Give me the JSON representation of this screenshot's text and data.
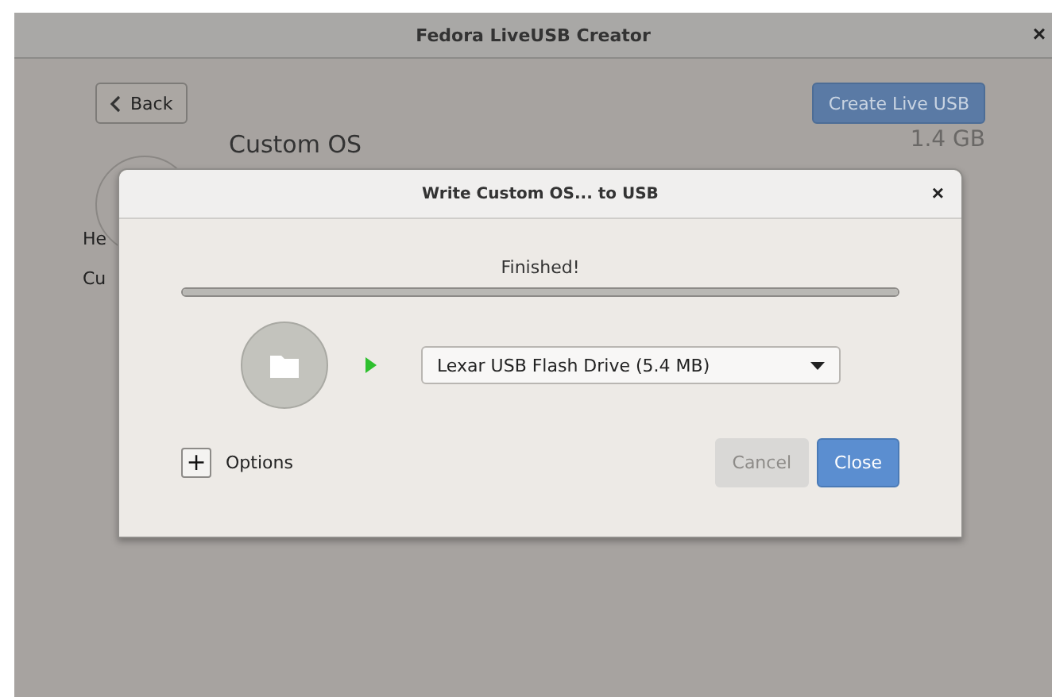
{
  "window": {
    "title": "Fedora LiveUSB Creator",
    "close": "×"
  },
  "toolbar": {
    "back": "Back",
    "create": "Create Live USB"
  },
  "image": {
    "name": "Custom OS",
    "size": "1.4 GB",
    "line_1": "He",
    "line_2": "Cu"
  },
  "dialog": {
    "title": "Write Custom OS... to USB",
    "close": "×",
    "status": "Finished!",
    "progress": {
      "level": 1
    },
    "drive": {
      "value": "Lexar USB Flash Drive (5.4 MB)"
    },
    "options": {
      "toggle": "+",
      "label": "Options",
      "expanded": false
    },
    "buttons": [
      {
        "label": "Cancel",
        "disabled": true,
        "kind": "secondary"
      },
      {
        "label": "Close",
        "disabled": false,
        "kind": "primary"
      }
    ]
  }
}
